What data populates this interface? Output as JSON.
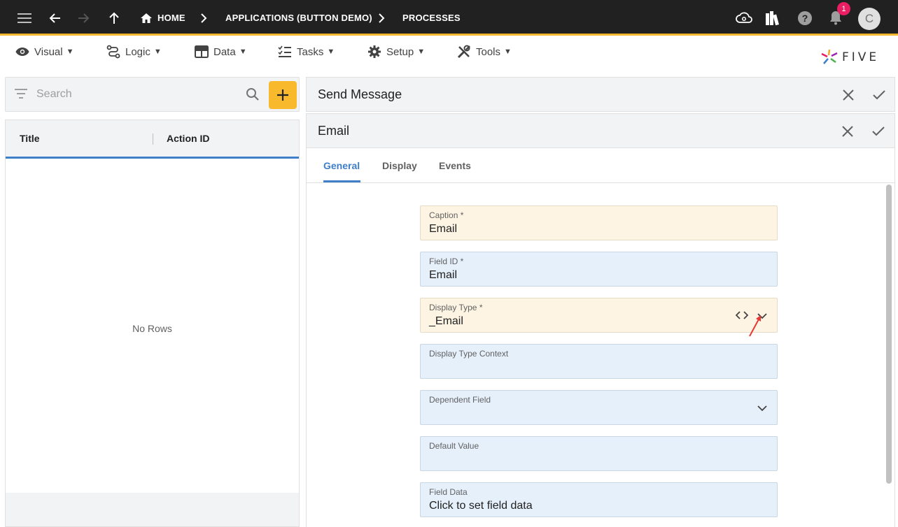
{
  "topbar": {
    "breadcrumbs": [
      {
        "label": "HOME"
      },
      {
        "label": "APPLICATIONS (BUTTON DEMO)"
      },
      {
        "label": "PROCESSES"
      }
    ],
    "notification_count": "1",
    "avatar_initial": "C",
    "accent_color": "#f5b82e"
  },
  "menu": {
    "items": [
      {
        "label": "Visual",
        "icon": "eye-icon"
      },
      {
        "label": "Logic",
        "icon": "logic-icon"
      },
      {
        "label": "Data",
        "icon": "table-icon"
      },
      {
        "label": "Tasks",
        "icon": "checklist-icon"
      },
      {
        "label": "Setup",
        "icon": "gear-icon"
      },
      {
        "label": "Tools",
        "icon": "tools-icon"
      }
    ],
    "caret": "▼",
    "logo_text": "FIVE"
  },
  "left": {
    "search_placeholder": "Search",
    "columns": [
      "Title",
      "Action ID"
    ],
    "empty_text": "No Rows"
  },
  "right": {
    "panel1_title": "Send Message",
    "panel2_title": "Email",
    "tabs": [
      {
        "label": "General",
        "active": true
      },
      {
        "label": "Display",
        "active": false
      },
      {
        "label": "Events",
        "active": false
      }
    ],
    "fields": [
      {
        "label": "Caption *",
        "value": "Email"
      },
      {
        "label": "Field ID *",
        "value": "Email"
      },
      {
        "label": "Display Type *",
        "value": "_Email"
      },
      {
        "label": "Display Type Context",
        "value": ""
      },
      {
        "label": "Dependent Field",
        "value": ""
      },
      {
        "label": "Default Value",
        "value": ""
      },
      {
        "label": "Field Data",
        "value": "Click to set field data"
      }
    ],
    "active_tab_color": "#3f7ec8",
    "required_field_color": "#fdf4e3",
    "optional_field_color": "#e6f0fb"
  }
}
